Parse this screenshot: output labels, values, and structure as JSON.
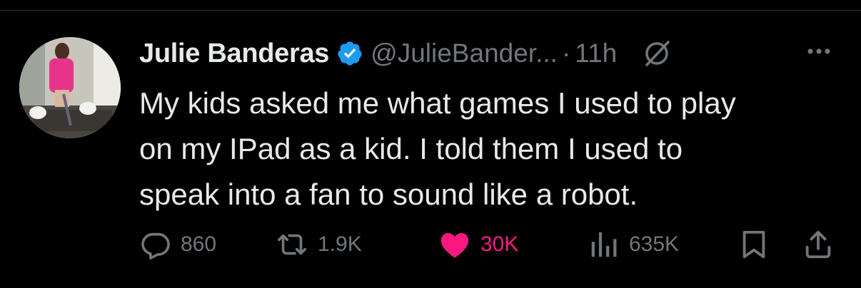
{
  "tweet": {
    "display_name": "Julie Banderas",
    "handle": "@JulieBander...",
    "separator": "·",
    "time": "11h",
    "text_lines": [
      "My kids asked me what games I used to play",
      "on my IPad as a kid. I told them I used to",
      "speak into a fan to sound like a robot."
    ]
  },
  "actions": {
    "replies": "860",
    "reposts": "1.9K",
    "likes": "30K",
    "views": "635K"
  },
  "colors": {
    "background": "#000000",
    "text": "#e7e9ea",
    "muted": "#71767b",
    "verified_blue": "#1d9bf0",
    "like_pink": "#f91880",
    "divider": "#2f3336"
  },
  "icons": {
    "verified": "verified-badge-icon",
    "grok": "grok-icon",
    "more": "more-icon",
    "reply": "reply-icon",
    "repost": "repost-icon",
    "like": "heart-icon",
    "views": "views-icon",
    "bookmark": "bookmark-icon",
    "share": "share-icon"
  }
}
